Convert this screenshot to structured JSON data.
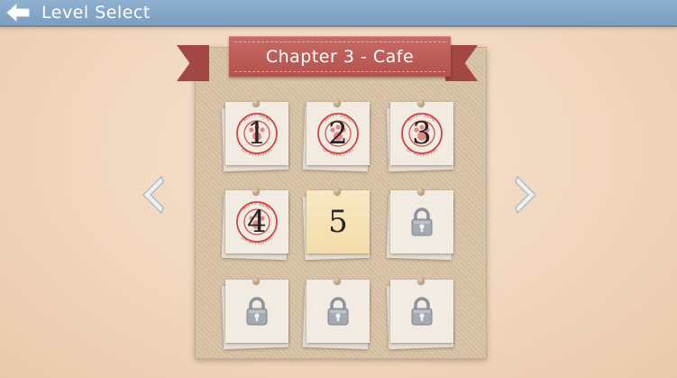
{
  "header": {
    "title": "Level Select",
    "back_icon": "back-arrow-icon"
  },
  "chapter": {
    "title": "Chapter 3 - Cafe"
  },
  "seal_text": {
    "top": "KITTY SEAL",
    "bottom": "OF APPROVAL"
  },
  "levels": [
    {
      "label": "1",
      "state": "completed"
    },
    {
      "label": "2",
      "state": "completed"
    },
    {
      "label": "3",
      "state": "completed"
    },
    {
      "label": "4",
      "state": "completed"
    },
    {
      "label": "5",
      "state": "current"
    },
    {
      "label": "",
      "state": "locked"
    },
    {
      "label": "",
      "state": "locked"
    },
    {
      "label": "",
      "state": "locked"
    },
    {
      "label": "",
      "state": "locked"
    }
  ],
  "colors": {
    "header_bar": "#7c9ec0",
    "ribbon": "#b3524d",
    "seal_red": "#c94a4a",
    "current_tile": "#f2dca8",
    "lock_gray": "#9aa0a6"
  }
}
